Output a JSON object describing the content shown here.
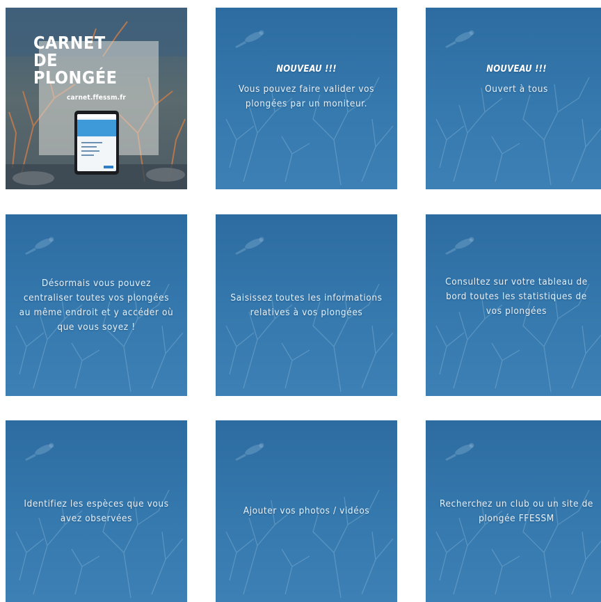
{
  "cover": {
    "title_lines": [
      "CARNET",
      "DE",
      "PLONGÉE"
    ],
    "url": "carnet.ffessm.fr"
  },
  "tiles": [
    {
      "badge": "NOUVEAU !!!",
      "text": "Vous pouvez faire valider vos plongées par un moniteur."
    },
    {
      "badge": "NOUVEAU !!!",
      "text": "Ouvert à tous"
    },
    {
      "text": "Désormais vous pouvez centraliser toutes vos plongées au même endroit et y accéder où que vous soyez !"
    },
    {
      "text": "Saisissez toutes les informations relatives à vos plongées"
    },
    {
      "text": "Consultez sur votre tableau de bord toutes les statistiques de vos plongées"
    },
    {
      "text": "Identifiez les espèces que vous avez observées"
    },
    {
      "text": "Ajouter vos photos / vidéos"
    },
    {
      "text": "Recherchez un club ou un site de plongée FFESSM"
    }
  ],
  "colors": {
    "tile_blue_top": "#2f6fa3",
    "tile_blue_bottom": "#3e82b8",
    "text": "#e9f1f8"
  }
}
